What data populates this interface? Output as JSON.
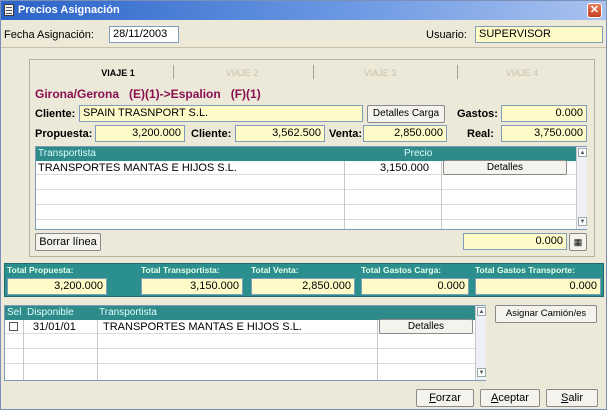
{
  "window": {
    "title": "Precios Asignación",
    "close": "✕"
  },
  "header": {
    "fecha_label": "Fecha Asignación:",
    "fecha_value": "28/11/2003",
    "usuario_label": "Usuario:",
    "usuario_value": "SUPERVISOR"
  },
  "tabs": [
    {
      "label": "VIAJE 1",
      "active": true
    },
    {
      "label": "VIAJE 2",
      "active": false
    },
    {
      "label": "VIAJE 3",
      "active": false
    },
    {
      "label": "VIAJE 4",
      "active": false
    }
  ],
  "trip": {
    "route": "Girona/Gerona   (E)(1)->Espalion   (F)(1)",
    "cliente_label": "Cliente:",
    "cliente_value": "SPAIN TRASNPORT S.L.",
    "detalles_carga": "Detalles Carga",
    "gastos_label": "Gastos:",
    "gastos_value": "0.000",
    "propuesta_label": "Propuesta:",
    "propuesta_value": "3,200.000",
    "cliente2_label": "Cliente:",
    "cliente2_value": "3,562.500",
    "venta_label": "Venta:",
    "venta_value": "2,850.000",
    "real_label": "Real:",
    "real_value": "3,750.000"
  },
  "transport_grid": {
    "columns": [
      "Transportista",
      "Precio"
    ],
    "rows": [
      {
        "transportista": "TRANSPORTES MANTAS E HIJOS S.L.",
        "precio": "3,150.000",
        "action": "Detalles"
      }
    ]
  },
  "grid_footer": {
    "borrar": "Borrar línea",
    "amount": "0.000"
  },
  "totals": {
    "propuesta_label": "Total Propuesta:",
    "propuesta_value": "3,200.000",
    "transportista_label": "Total Transportista:",
    "transportista_value": "3,150.000",
    "venta_label": "Total Venta:",
    "venta_value": "2,850.000",
    "gastos_carga_label": "Total Gastos Carga:",
    "gastos_carga_value": "0.000",
    "gastos_transporte_label": "Total Gastos Transporte:",
    "gastos_transporte_value": "0.000"
  },
  "available_grid": {
    "columns": [
      "Sel",
      "Disponible",
      "Transportista"
    ],
    "rows": [
      {
        "disponible": "31/01/01",
        "transportista": "TRANSPORTES MANTAS E HIJOS S.L.",
        "action": "Detalles"
      }
    ],
    "asignar": "Asignar Camión/es"
  },
  "footer": {
    "forzar": "Forzar",
    "aceptar": "Aceptar",
    "salir": "Salir"
  }
}
